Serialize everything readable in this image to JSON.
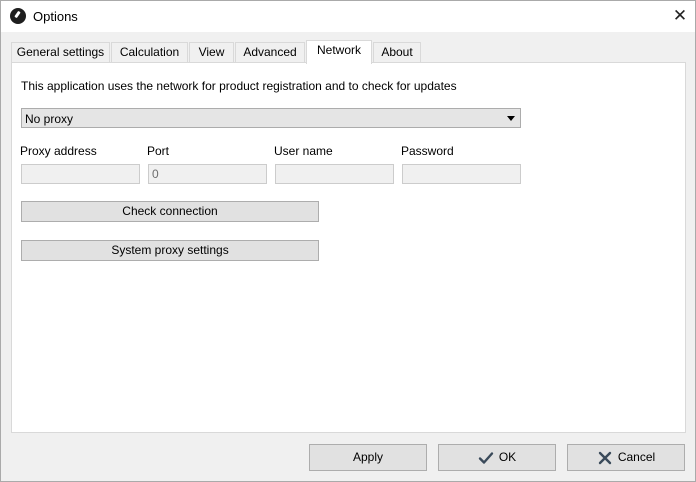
{
  "window": {
    "title": "Options",
    "close_glyph": "✕"
  },
  "tabs": [
    {
      "label": "General settings"
    },
    {
      "label": "Calculation"
    },
    {
      "label": "View"
    },
    {
      "label": "Advanced"
    },
    {
      "label": "Network",
      "active": true
    },
    {
      "label": "About"
    }
  ],
  "network": {
    "info_text": "This application uses the network for product registration and to check for updates",
    "proxy_select": {
      "value": "No proxy"
    },
    "fields": {
      "proxy_address": {
        "label": "Proxy address",
        "value": ""
      },
      "port": {
        "label": "Port",
        "value": "0"
      },
      "user_name": {
        "label": "User name",
        "value": ""
      },
      "password": {
        "label": "Password",
        "value": ""
      }
    },
    "check_connection_label": "Check connection",
    "system_proxy_label": "System proxy settings"
  },
  "footer": {
    "apply_label": "Apply",
    "ok_label": "OK",
    "cancel_label": "Cancel"
  },
  "icons": {
    "app": "app-icon",
    "ok": "checkmark-icon",
    "cancel": "cross-icon"
  },
  "colors": {
    "dark_icon": "#3a4a5a"
  }
}
